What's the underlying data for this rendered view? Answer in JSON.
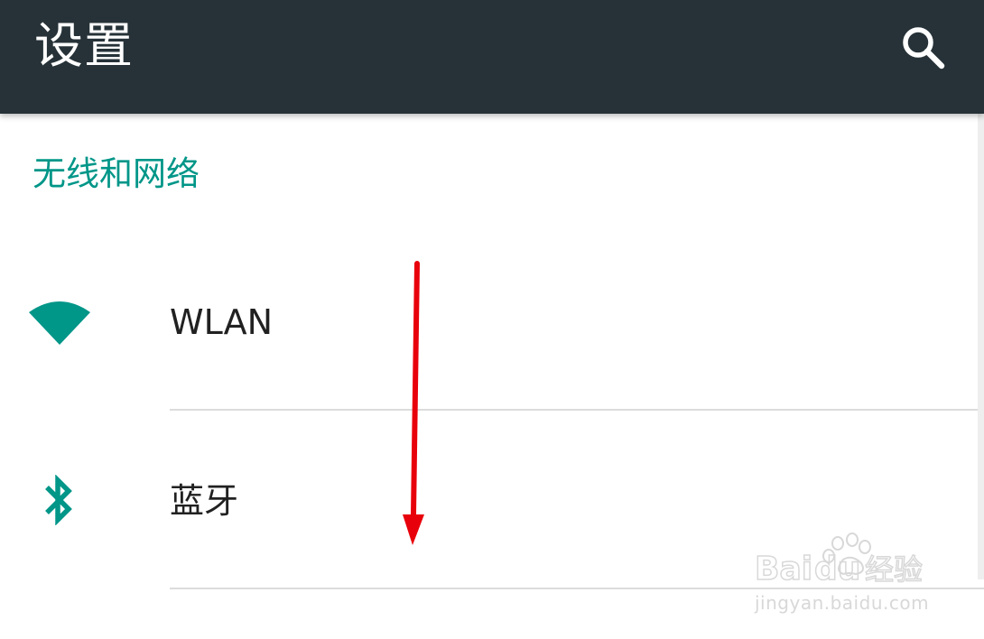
{
  "app_bar": {
    "title": "设置",
    "search_icon": "search-icon",
    "background": "#263238"
  },
  "section": {
    "header": "无线和网络",
    "color": "#009688"
  },
  "items": [
    {
      "label": "WLAN",
      "icon": "wifi-icon"
    },
    {
      "label": "蓝牙",
      "icon": "bluetooth-icon"
    }
  ],
  "annotation": {
    "arrow_color": "#e8000b",
    "direction": "down"
  },
  "watermark": {
    "logo_text": "Baidu经验",
    "url": "jingyan.baidu.com"
  }
}
